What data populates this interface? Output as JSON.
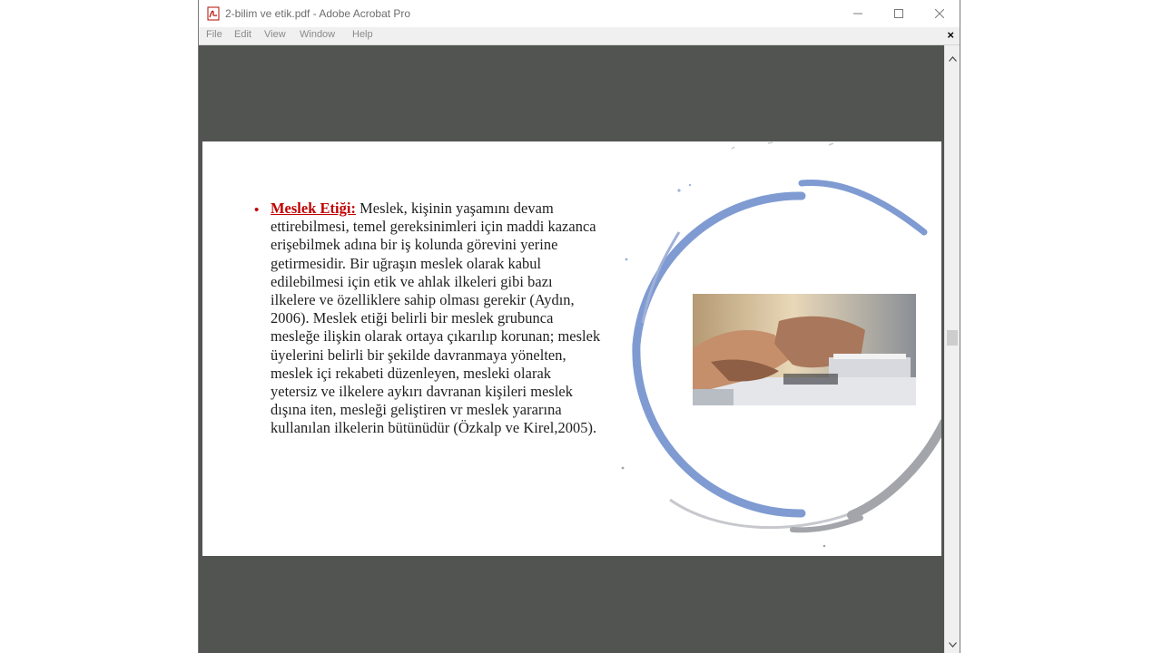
{
  "window": {
    "title": "2-bilim ve etik.pdf - Adobe Acrobat Pro",
    "app_icon": "pdf-file-icon"
  },
  "controls": {
    "minimize_icon": "minimize-icon",
    "maximize_icon": "maximize-icon",
    "close_icon": "close-icon"
  },
  "menu": {
    "items": [
      "File",
      "Edit",
      "View",
      "Window",
      "Help"
    ],
    "close_glyph": "×"
  },
  "slide": {
    "bullet": "•",
    "term": "Meslek Etiği:",
    "body": " Meslek, kişinin yaşamını devam ettirebilmesi, temel gereksinimleri için maddi kazanca erişebilmek adına bir iş kolunda görevini yerine getirmesidir. Bir uğraşın meslek olarak kabul edilebilmesi için etik ve ahlak ilkeleri gibi bazı ilkelere ve özelliklere sahip olması gerekir (Aydın, 2006). Meslek etiği belirli bir meslek grubunca mesleğe ilişkin olarak ortaya çıkarılıp korunan; meslek üyelerini belirli bir şekilde davranmaya yönelten, meslek içi rekabeti düzenleyen, mesleki olarak yetersiz ve ilkelere aykırı davranan kişileri meslek dışına iten, mesleği geliştiren vr meslek yararına kullanılan ilkelerin bütünüdür (Özkalp ve Kirel,2005).",
    "image": "handshake-photo"
  },
  "colors": {
    "viewer_bg": "#525451",
    "accent_red": "#c00000",
    "circle_blue": "#7f9bd2",
    "circle_grey": "#a3a5ab"
  }
}
